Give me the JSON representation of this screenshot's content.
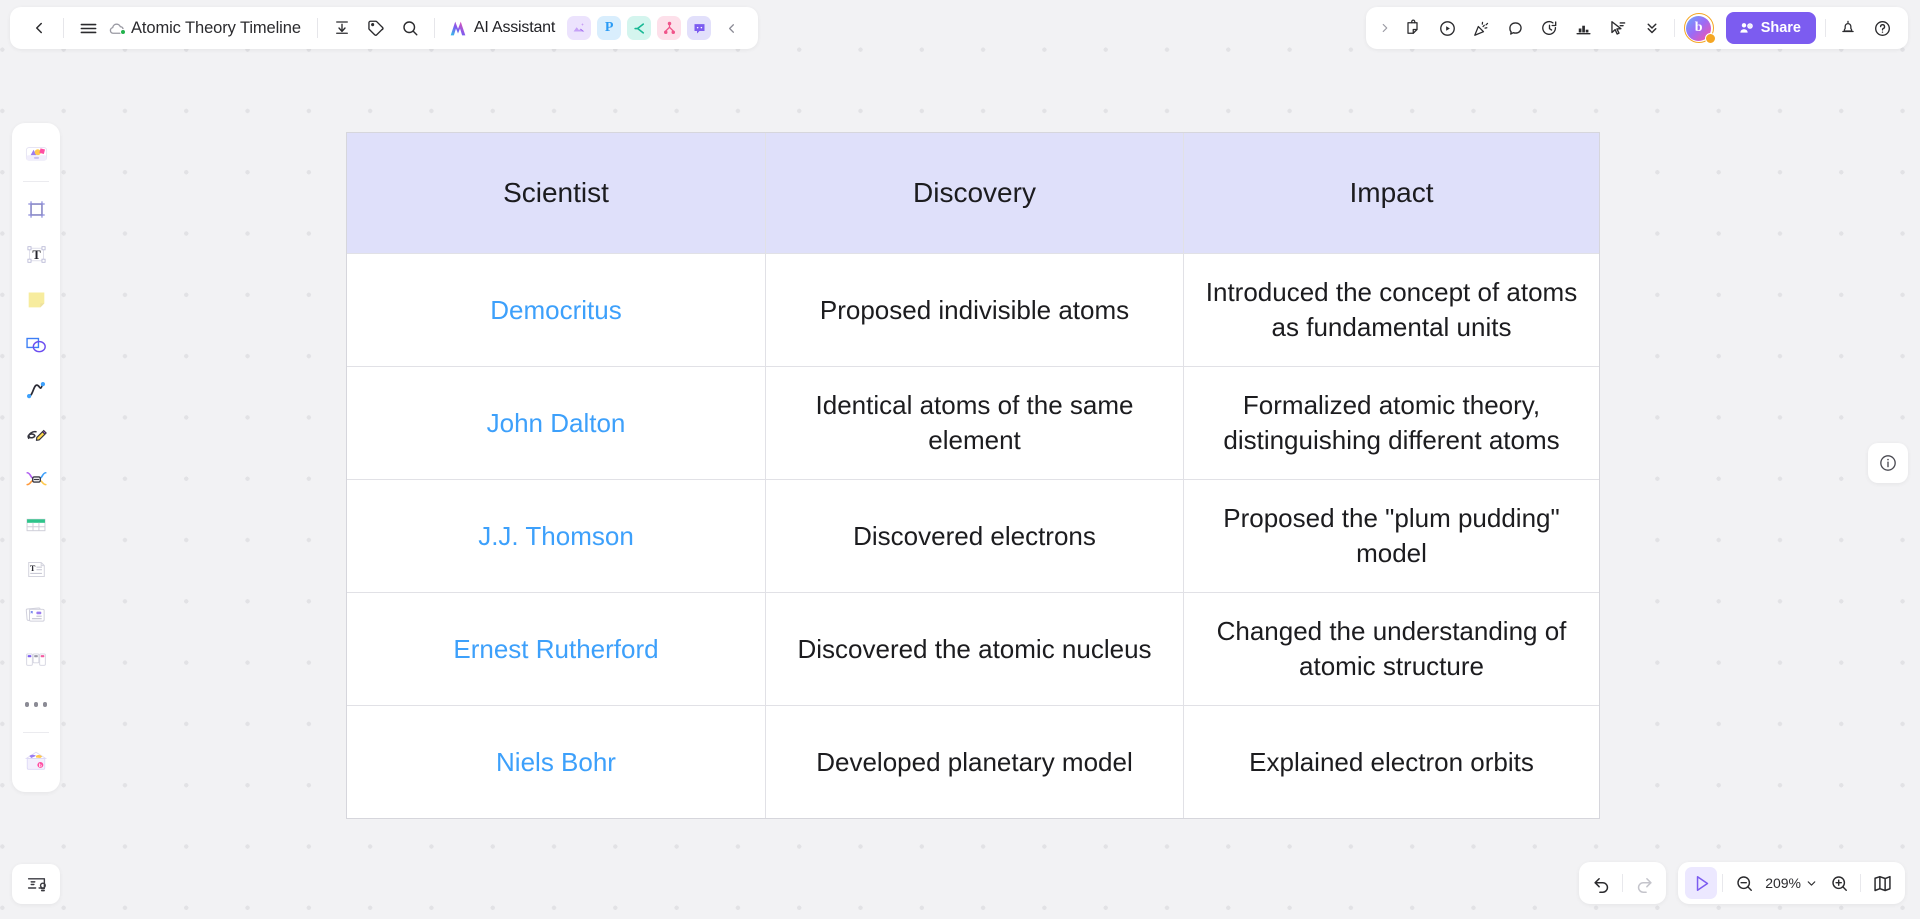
{
  "header": {
    "back_icon": "chevron-left-icon",
    "menu_icon": "hamburger-menu-icon",
    "sync_icon": "cloud-synced-icon",
    "doc_title": "Atomic Theory Timeline",
    "download_icon": "download-icon",
    "tag_icon": "tag-icon",
    "search_icon": "search-icon",
    "ai_assistant_label": "AI Assistant",
    "app_chips": [
      {
        "name": "image-app-icon",
        "glyph": "",
        "bg": "#ece3fd",
        "fg": "#a06cf0"
      },
      {
        "name": "presentation-app-icon",
        "glyph": "P",
        "bg": "#d9eefd",
        "fg": "#2b9bf5"
      },
      {
        "name": "concept-map-app-icon",
        "glyph": "",
        "bg": "#d4f5ee",
        "fg": "#18b894"
      },
      {
        "name": "mindmap-app-icon",
        "glyph": "",
        "bg": "#fde0ea",
        "fg": "#f0548a"
      },
      {
        "name": "comment-app-icon",
        "glyph": "",
        "bg": "#e2e0fb",
        "fg": "#7c5cf0"
      }
    ],
    "collapse_icon": "chevron-left-icon"
  },
  "right_toolbar": {
    "expand_icon": "chevron-right-icon",
    "tools": [
      {
        "name": "sticker-tool-icon"
      },
      {
        "name": "play-record-tool-icon"
      },
      {
        "name": "celebrate-tool-icon"
      },
      {
        "name": "comment-bubble-tool-icon"
      },
      {
        "name": "timer-tool-icon"
      },
      {
        "name": "vote-chart-tool-icon"
      },
      {
        "name": "pointer-broadcast-tool-icon"
      },
      {
        "name": "more-chevrons-icon"
      }
    ],
    "avatar_initial": "b",
    "share_label": "Share",
    "share_icon": "person-add-icon",
    "bell_icon": "notification-bell-icon",
    "help_icon": "help-circle-icon"
  },
  "sidebar": {
    "tools": [
      {
        "name": "shapes-library-tool",
        "label": "Shapes"
      },
      {
        "name": "frame-tool",
        "label": "Frame"
      },
      {
        "name": "text-tool",
        "label": "Text"
      },
      {
        "name": "sticky-note-tool",
        "label": "Sticky note"
      },
      {
        "name": "shape-tool",
        "label": "Shape"
      },
      {
        "name": "connector-tool",
        "label": "Connector"
      },
      {
        "name": "pen-draw-tool",
        "label": "Pen"
      },
      {
        "name": "mindmap-tool",
        "label": "Mind map"
      },
      {
        "name": "table-tool",
        "label": "Table"
      },
      {
        "name": "document-tool",
        "label": "Document"
      },
      {
        "name": "card-tool",
        "label": "Cards"
      },
      {
        "name": "kanban-tool",
        "label": "Kanban"
      },
      {
        "name": "more-tools",
        "label": "More"
      },
      {
        "name": "apps-store-tool",
        "label": "Apps"
      }
    ]
  },
  "canvas_controls": {
    "presentation_icon": "presentation-card-icon",
    "info_icon": "info-circle-icon",
    "undo_icon": "undo-arrow-icon",
    "redo_icon": "redo-arrow-icon",
    "cursor_icon": "cursor-select-icon",
    "zoom_out_icon": "zoom-out-icon",
    "zoom_in_icon": "zoom-in-icon",
    "zoom_level": "209%",
    "zoom_chevron_icon": "chevron-down-icon",
    "minimap_icon": "minimap-book-icon"
  },
  "table": {
    "headers": [
      "Scientist",
      "Discovery",
      "Impact"
    ],
    "header_bg": "#dfe0fa",
    "link_color": "#3da0fb",
    "rows": [
      {
        "scientist": "Democritus",
        "discovery": "Proposed indivisible atoms",
        "impact": "Introduced the concept of atoms as fundamental units"
      },
      {
        "scientist": "John Dalton",
        "discovery": "Identical atoms of the same element",
        "impact": "Formalized atomic theory, distinguishing different atoms"
      },
      {
        "scientist": "J.J. Thomson",
        "discovery": "Discovered electrons",
        "impact": "Proposed the \"plum pudding\" model"
      },
      {
        "scientist": "Ernest Rutherford",
        "discovery": "Discovered the atomic nucleus",
        "impact": "Changed the understanding of atomic structure"
      },
      {
        "scientist": "Niels Bohr",
        "discovery": "Developed planetary model",
        "impact": "Explained electron orbits"
      }
    ]
  }
}
